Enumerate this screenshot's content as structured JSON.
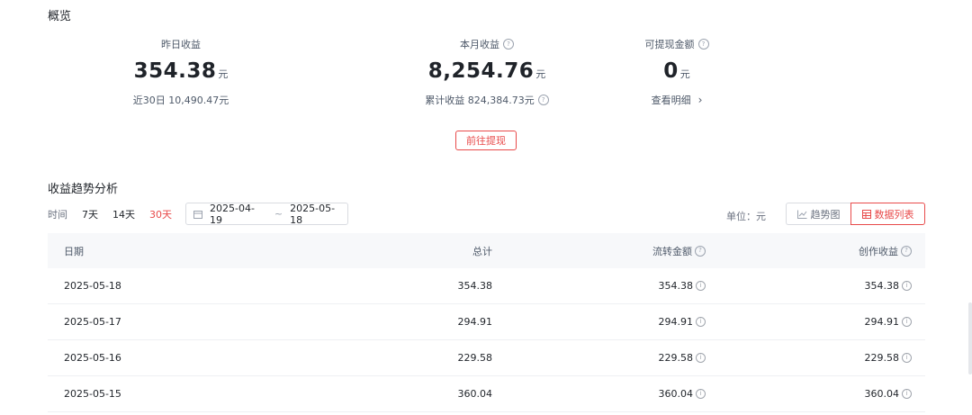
{
  "overview": {
    "title": "概览",
    "stats": [
      {
        "label": "昨日收益",
        "value": "354.38",
        "unit": "元",
        "sub": "近30日 10,490.47元",
        "has_help": false,
        "sub_help": false
      },
      {
        "label": "本月收益",
        "value": "8,254.76",
        "unit": "元",
        "sub": "累计收益 824,384.73元",
        "has_help": true,
        "sub_help": true
      },
      {
        "label": "可提现金额",
        "value": "0",
        "unit": "元",
        "sub": "查看明细",
        "has_help": true,
        "sub_help": false
      }
    ],
    "withdraw_label": "前往提现"
  },
  "trend": {
    "title": "收益趋势分析",
    "time_label": "时间",
    "ranges": [
      "7天",
      "14天",
      "30天"
    ],
    "active_range": "30天",
    "date_start": "2025-04-19",
    "date_sep": "~",
    "date_end": "2025-05-18",
    "unit_label": "单位：元",
    "view_trend_label": "趋势图",
    "view_list_label": "数据列表"
  },
  "table": {
    "headers": {
      "date": "日期",
      "total": "总计",
      "flow": "流转金额",
      "create": "创作收益"
    },
    "rows": [
      {
        "date": "2025-05-18",
        "total": "354.38",
        "flow": "354.38",
        "create": "354.38"
      },
      {
        "date": "2025-05-17",
        "total": "294.91",
        "flow": "294.91",
        "create": "294.91"
      },
      {
        "date": "2025-05-16",
        "total": "229.58",
        "flow": "229.58",
        "create": "229.58"
      },
      {
        "date": "2025-05-15",
        "total": "360.04",
        "flow": "360.04",
        "create": "360.04"
      }
    ]
  },
  "colors": {
    "accent": "#e84a4a",
    "text": "#1f2329",
    "muted": "#4e5969",
    "header_bg": "#f7f8fa"
  },
  "icons": {
    "help": "question-circle-icon",
    "info": "info-circle-icon",
    "calendar": "calendar-icon",
    "trend": "line-chart-icon",
    "list": "table-grid-icon",
    "chevron": "chevron-right-icon"
  }
}
